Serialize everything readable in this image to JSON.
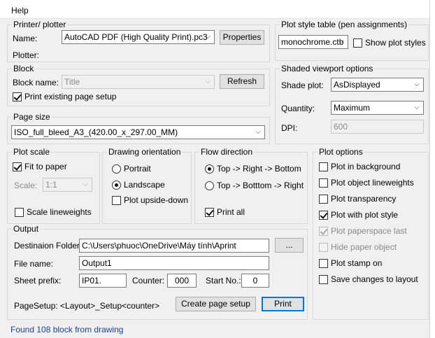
{
  "menu": {
    "help": "Help"
  },
  "printer": {
    "group_label": "Printer/ plotter",
    "name_label": "Name:",
    "name_value": "AutoCAD PDF (High Quality Print).pc3",
    "properties_button": "Properties",
    "plotter_label": "Plotter:"
  },
  "plot_style_table": {
    "group_label": "Plot style table (pen assignments)",
    "value": "monochrome.ctb",
    "show_plot_styles_label": "Show plot styles",
    "show_plot_styles_checked": false
  },
  "block": {
    "group_label": "Block",
    "block_name_label": "Block name:",
    "block_name_placeholder": "Title",
    "refresh_button": "Refresh",
    "print_existing_label": "Print existing page setup",
    "print_existing_checked": true
  },
  "shaded_viewport": {
    "group_label": "Shaded viewport options",
    "shade_plot_label": "Shade plot:",
    "shade_plot_value": "AsDisplayed",
    "quantity_label": "Quantity:",
    "quantity_value": "Maximum",
    "dpi_label": "DPI:",
    "dpi_value": "600"
  },
  "page_size": {
    "group_label": "Page size",
    "value": "ISO_full_bleed_A3_(420.00_x_297.00_MM)"
  },
  "plot_scale": {
    "group_label": "Plot scale",
    "fit_to_paper_label": "Fit to paper",
    "fit_to_paper_checked": true,
    "scale_label": "Scale:",
    "scale_value": "1:1",
    "scale_lineweights_label": "Scale lineweights",
    "scale_lineweights_checked": false
  },
  "orientation": {
    "group_label": "Drawing orientation",
    "portrait_label": "Portrait",
    "landscape_label": "Landscape",
    "selected": "Landscape",
    "upside_down_label": "Plot upside-down",
    "upside_down_checked": false
  },
  "flow": {
    "group_label": "Flow direction",
    "option1_label": "Top -> Right -> Bottom",
    "option2_label": "Top -> Botttom -> Right",
    "selected": "Top -> Right -> Bottom",
    "print_all_label": "Print all",
    "print_all_checked": true
  },
  "plot_options": {
    "group_label": "Plot options",
    "items": [
      {
        "label": "Plot in background",
        "checked": false,
        "enabled": true
      },
      {
        "label": "Plot object lineweights",
        "checked": false,
        "enabled": true
      },
      {
        "label": "Plot transparency",
        "checked": false,
        "enabled": true
      },
      {
        "label": "Plot with plot style",
        "checked": true,
        "enabled": true
      },
      {
        "label": "Plot paperspace last",
        "checked": true,
        "enabled": false
      },
      {
        "label": "Hide paper object",
        "checked": false,
        "enabled": false
      },
      {
        "label": "Plot stamp on",
        "checked": false,
        "enabled": true
      },
      {
        "label": "Save changes to layout",
        "checked": false,
        "enabled": true
      }
    ]
  },
  "output": {
    "group_label": "Output",
    "dest_folder_label": "Destinaion Folder:",
    "dest_folder_value": "C:\\Users\\phuoc\\OneDrive\\Máy tính\\Aprint",
    "browse_button": "...",
    "file_name_label": "File name:",
    "file_name_value": "Output1",
    "sheet_prefix_label": "Sheet prefix:",
    "sheet_prefix_value": "IP01.",
    "counter_label": "Counter:",
    "counter_value": "000",
    "start_no_label": "Start No.:",
    "start_no_value": "0",
    "pagesetup_text": "PageSetup: <Layout>_Setup<counter>",
    "create_page_setup_button": "Create page setup",
    "print_button": "Print"
  },
  "status": {
    "text": "Found 108 block from drawing"
  },
  "colors": {
    "status_text": "#1a3da0",
    "default_button_border": "#0078d7",
    "background": "#f0f0f0"
  }
}
